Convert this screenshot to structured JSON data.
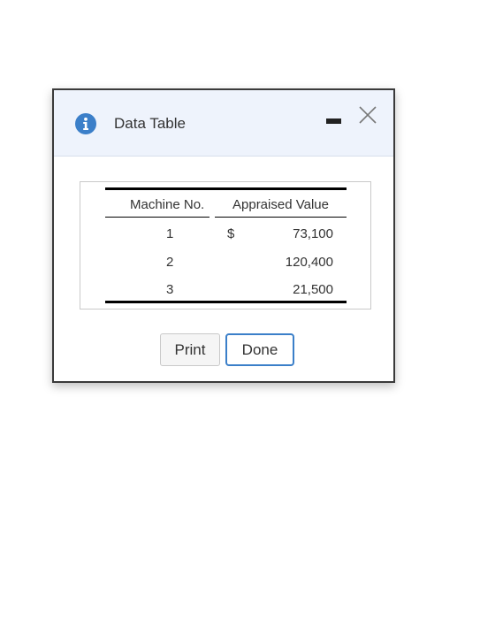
{
  "dialog": {
    "title": "Data Table",
    "icons": {
      "info": "info-icon",
      "minimize": "minimize-icon",
      "close": "close-icon"
    }
  },
  "table": {
    "columns": [
      "Machine No.",
      "Appraised Value"
    ],
    "currency_symbol": "$",
    "rows": [
      {
        "machine": "1",
        "value": "73,100"
      },
      {
        "machine": "2",
        "value": "120,400"
      },
      {
        "machine": "3",
        "value": "21,500"
      }
    ]
  },
  "buttons": {
    "print_label": "Print",
    "done_label": "Done"
  },
  "colors": {
    "accent": "#3b7fc9",
    "header_bg": "#eef3fc"
  }
}
